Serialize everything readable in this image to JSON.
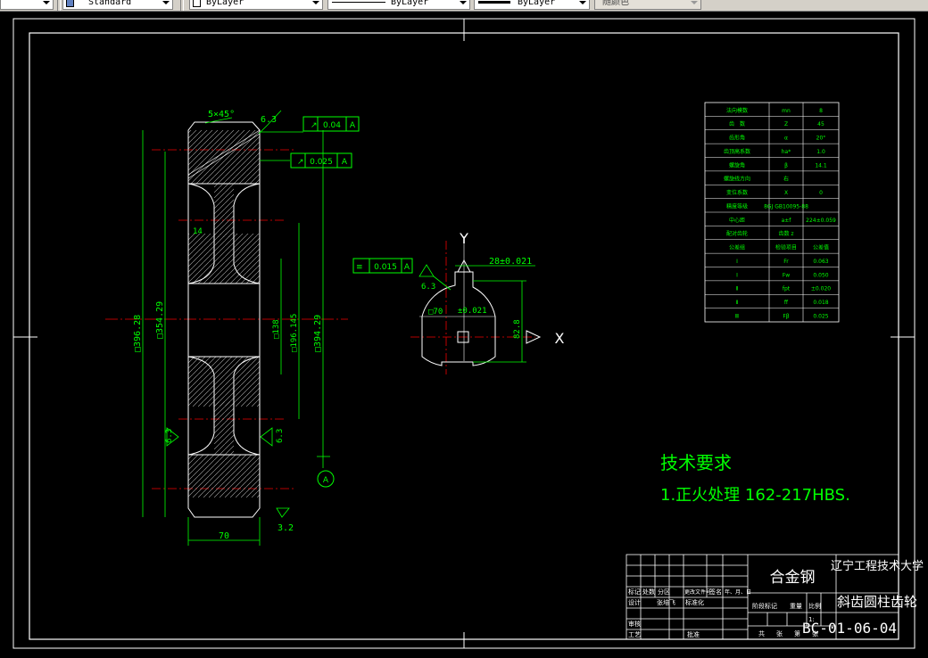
{
  "toolbar": {
    "text_style": "Standard",
    "layer": "ByLayer",
    "linetype": "ByLayer",
    "lineweight": "ByLayer",
    "plot_style": "随颜色"
  },
  "drawing": {
    "axis_x": "X",
    "axis_y": "Y",
    "tech_req_title": "技术要求",
    "tech_req_item": "1.正火处理 162-217HBS.",
    "chamfer": "5×45°",
    "rough_63a": "6.3",
    "rough_63b": "6.3",
    "rough_63c": "6.3",
    "rough_63d": "6.3",
    "rough_32": "3.2",
    "tol1_value": "0.04",
    "tol1_datum": "A",
    "tol2_value": "0.025",
    "tol2_datum": "A",
    "tol3_value": "0.015",
    "tol3_datum": "A",
    "dim_width": "70",
    "dim_14": "14",
    "dim_keyway": "28±0.021",
    "dim_bore": "□70",
    "dim_bore2": "±0.021",
    "dim_height": "82.8",
    "dim_o1": "□396.28",
    "dim_o2": "□354.29",
    "dim_o3": "□138",
    "dim_o4": "□196.145",
    "dim_o5": "□394.29",
    "datum_label": "A"
  },
  "gear_table": [
    [
      "法向模数",
      "mn",
      "8"
    ],
    [
      "齿　数",
      "Z",
      "45"
    ],
    [
      "齿形角",
      "α",
      "20°"
    ],
    [
      "齿顶高系数",
      "ha*",
      "1.0"
    ],
    [
      "螺旋角",
      "β",
      "14.1"
    ],
    [
      "螺旋线方向",
      "右",
      ""
    ],
    [
      "变位系数",
      "X",
      "0"
    ],
    [
      "精度等级",
      "8GJ GB10095-88",
      ""
    ],
    [
      "中心距",
      "a±f",
      "224±0.059"
    ],
    [
      "配对齿轮",
      "齿数 z",
      ""
    ],
    [
      "公差组",
      "检验项目",
      "公差值"
    ],
    [
      "Ⅰ",
      "Fr",
      "0.063"
    ],
    [
      "Ⅰ",
      "Fw",
      "0.050"
    ],
    [
      "Ⅱ",
      "fpt",
      "±0.020"
    ],
    [
      "Ⅱ",
      "ff",
      "0.018"
    ],
    [
      "Ⅲ",
      "Fβ",
      "0.025"
    ]
  ],
  "title_block": {
    "material": "合金钢",
    "school": "辽宁工程技术大学",
    "part_name": "斜齿圆柱齿轮",
    "drawing_no": "BC-01-06-04",
    "scale": "1:",
    "rev_headers": [
      "标记",
      "处数",
      "分区",
      "更改文件号",
      "签名",
      "年、月、日"
    ],
    "row_design": [
      "设计",
      "张培飞",
      "标准化"
    ],
    "row_stage": [
      "阶段标记",
      "重量",
      "比例"
    ],
    "row_review": "审核",
    "row_process": "工艺",
    "row_approve": "批准",
    "row_sheets": [
      "共",
      "张",
      "第",
      "张"
    ]
  }
}
